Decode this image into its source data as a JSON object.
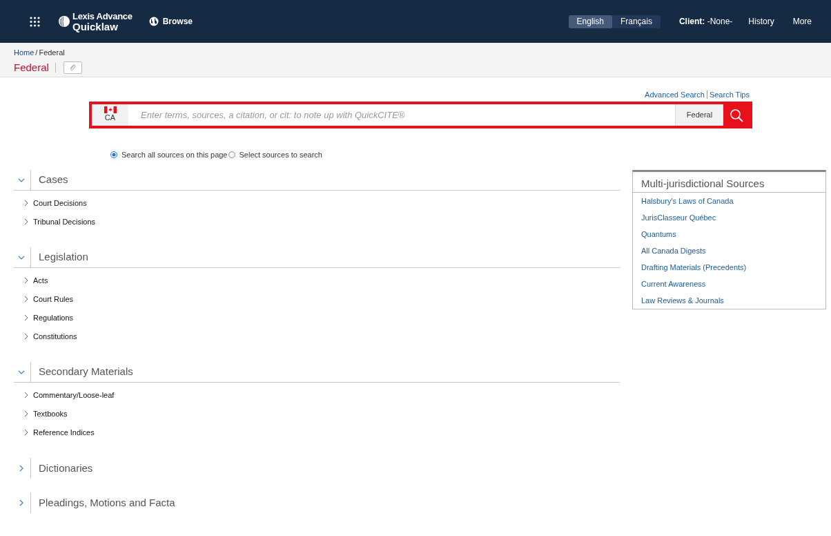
{
  "header": {
    "logo_line_1": "Lexis Advance",
    "logo_line_2": "Quicklaw",
    "browse": "Browse",
    "languages": [
      {
        "label": "English",
        "selected": true
      },
      {
        "label": "Français",
        "selected": false
      }
    ],
    "client": "**Client:** -None-",
    "links": [
      "History",
      "More"
    ]
  },
  "breadcrumb": [
    "Home",
    "Federal"
  ],
  "breadcrumb_separator": "/",
  "page_title": "Federal",
  "search": {
    "links": [
      "Advanced Search",
      "Search Tips"
    ],
    "country": "CA",
    "placeholder": "Enter terms, sources, a citation, or cit: to note up with QuickCITE®",
    "jurisdiction": "Federal"
  },
  "search_scope": [
    {
      "label": "Search all sources on this page",
      "selected": true
    },
    {
      "label": "Select sources to search",
      "selected": false
    }
  ],
  "sections": [
    {
      "title": "Cases",
      "expanded": true,
      "items": [
        "Court Decisions",
        "Tribunal Decisions"
      ]
    },
    {
      "title": "Legislation",
      "expanded": true,
      "items": [
        "Acts",
        "Court Rules",
        "Regulations",
        "Constitutions"
      ]
    },
    {
      "title": "Secondary Materials",
      "expanded": true,
      "items": [
        "Commentary/Loose-leaf",
        "Textbooks",
        "Reference Indices"
      ]
    },
    {
      "title": "Dictionaries",
      "expanded": false
    },
    {
      "title": "Pleadings, Motions and Facta",
      "expanded": false
    }
  ],
  "side_panel": {
    "title": "Multi-jurisdictional Sources",
    "links": [
      "Halsbury's Laws of Canada",
      "JurisClasseur Québec",
      "Quantums",
      "All Canada Digests",
      "Drafting Materials (Precedents)",
      "Current Awareness",
      "Law Reviews & Journals"
    ]
  }
}
